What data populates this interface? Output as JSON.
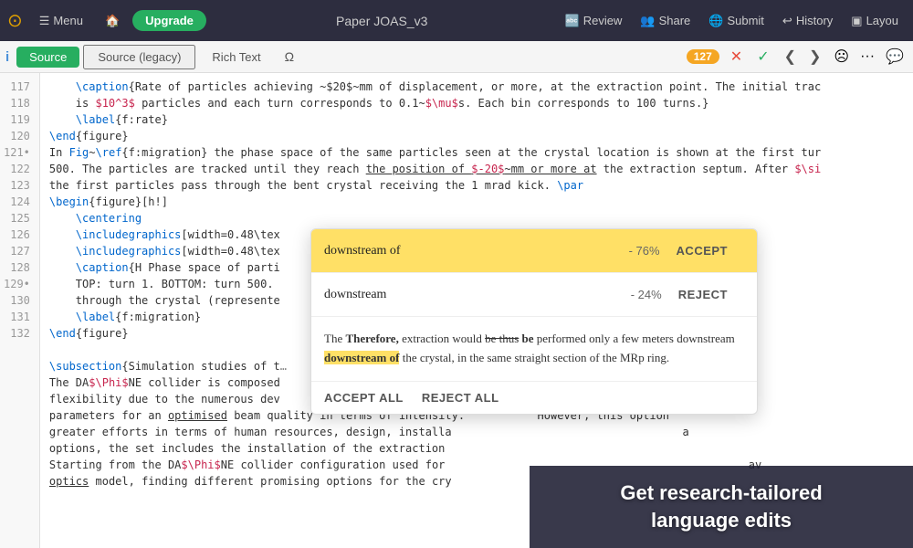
{
  "navbar": {
    "logo": "⊙",
    "menu_label": "Menu",
    "home_icon": "🏠",
    "upgrade_label": "Upgrade",
    "title": "Paper JOAS_v3",
    "review_label": "Review",
    "share_label": "Share",
    "submit_label": "Submit",
    "history_label": "History",
    "layout_label": "Layou"
  },
  "toolbar": {
    "info_icon": "i",
    "source_label": "Source",
    "source_legacy_label": "Source (legacy)",
    "rich_text_label": "Rich Text",
    "omega": "Ω",
    "badge_count": "127",
    "close_icon": "✕",
    "check_icon": "✓",
    "arrow_left": "❮",
    "arrow_right": "❯",
    "emoji1": "☹",
    "emoji2": "···",
    "comment_icon": "💬"
  },
  "lines": [
    {
      "num": "117",
      "content": "\\caption{Rate of particles achieving ~$20$~mm of displacement, or more, at the extraction point. The initial trac"
    },
    {
      "num": "",
      "content": "is $10^3$ particles and each turn corresponds to 0.1~$\\mu$s. Each bin corresponds to 100 turns.}"
    },
    {
      "num": "118",
      "content": "\\label{f:rate}"
    },
    {
      "num": "119",
      "content": "\\end{figure}"
    },
    {
      "num": "120",
      "content": "In Fig~\\ref{f:migration} the phase space of the same particles seen at the crystal location is shown at the first tur"
    },
    {
      "num": "",
      "content": "500. The particles are tracked until they reach the position of $-20$~mm or more at the extraction septum. After $\\si"
    },
    {
      "num": "",
      "content": "the first particles pass through the bent crystal receiving the 1 mrad kick. \\par"
    },
    {
      "num": "121",
      "content": "\\begin{figure}[h!]"
    },
    {
      "num": "122",
      "content": "\\centering"
    },
    {
      "num": "123",
      "content": "\\includegraphics[width=0.48\\tex"
    },
    {
      "num": "124",
      "content": "\\includegraphics[width=0.48\\tex"
    },
    {
      "num": "125",
      "content": "\\caption{H Phase space of parti"
    },
    {
      "num": "",
      "content": "TOP: turn 1. BOTTOM: turn 500."
    },
    {
      "num": "",
      "content": "through the crystal (represente"
    },
    {
      "num": "126",
      "content": "\\label{f:migration}"
    },
    {
      "num": "127",
      "content": "\\end{figure}"
    },
    {
      "num": "128",
      "content": ""
    },
    {
      "num": "129",
      "content": "\\subsection{Simulation studies of t"
    },
    {
      "num": "130",
      "content": "The DA$\\Phi$NE collider is composed"
    },
    {
      "num": "",
      "content": "flexibility due to the numerous dev"
    },
    {
      "num": "",
      "content": "parameters for an optimised beam quality in terms of intensity."
    },
    {
      "num": "",
      "content": "greater efforts in terms of human resources, design, installa"
    },
    {
      "num": "",
      "content": "options, the set includes the installation of the extraction"
    },
    {
      "num": "131",
      "content": "Starting from the DA$\\Phi$NE collider configuration used for"
    },
    {
      "num": "",
      "content": "optics model, finding different promising options for the cry"
    },
    {
      "num": "132",
      "content": ""
    }
  ],
  "suggestion": {
    "title": "Suggestion popup",
    "options": [
      {
        "text": "downstream of",
        "pct": "- 76%",
        "selected": true,
        "action": "ACCEPT"
      },
      {
        "text": "downstream",
        "pct": "- 24%",
        "selected": false,
        "action": "REJECT"
      }
    ],
    "preview_text_before": "The ",
    "preview_therefore": "Therefore,",
    "preview_text_mid1": " extraction would ",
    "preview_strike1": "be thus",
    "preview_be": " be",
    "preview_text_mid2": " performed only a few meters ",
    "preview_downstream": "downstream",
    "preview_downstream_of": " downstream of",
    "preview_text_after": " the crystal, in the same straight section of the MRp ring.",
    "accept_all": "ACCEPT ALL",
    "reject_all": "REJECT ALL"
  },
  "promo": {
    "text": "Get research-tailored\nlanguage edits"
  }
}
